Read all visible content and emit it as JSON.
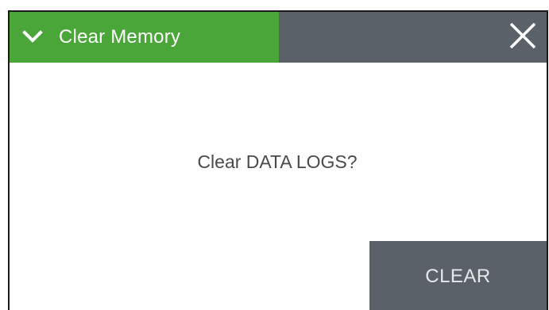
{
  "dialog": {
    "title": "Clear Memory",
    "message": "Clear DATA LOGS?",
    "clear_button_label": "CLEAR"
  },
  "icons": {
    "collapse": "chevron-down-icon",
    "close": "close-icon"
  },
  "colors": {
    "accent": "#4ba63a",
    "header_bg": "#5a6168",
    "button_bg": "#5a6168"
  }
}
